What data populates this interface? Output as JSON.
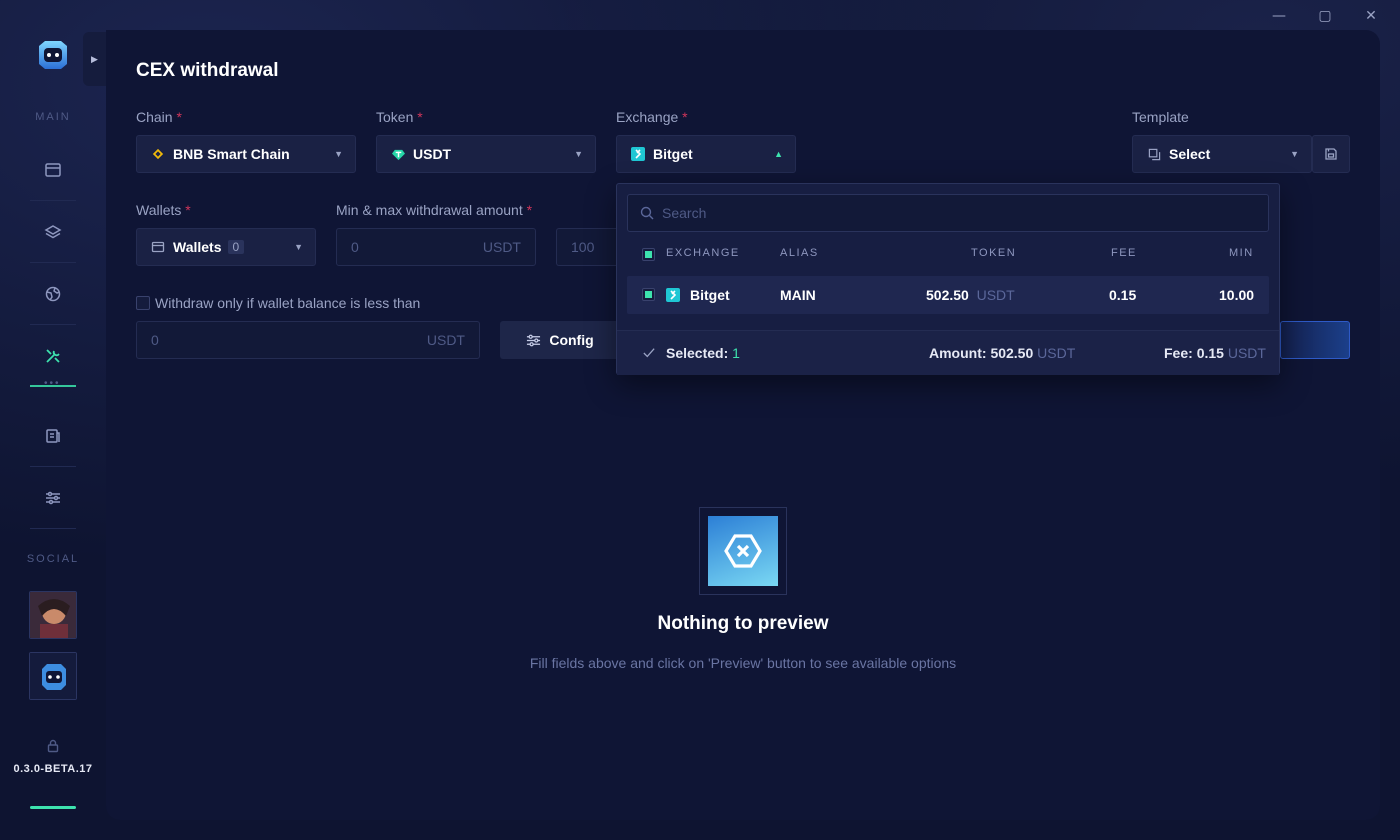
{
  "window": {
    "minimize": "—",
    "maximize": "▢",
    "close": "✕"
  },
  "sidebar": {
    "sections": {
      "main": "MAIN",
      "social": "SOCIAL"
    },
    "version": "0.3.0-BETA.17",
    "accent": "#3de3ae"
  },
  "page": {
    "title": "CEX withdrawal"
  },
  "form": {
    "chain": {
      "label": "Chain",
      "required": "*",
      "value": "BNB Smart Chain"
    },
    "token": {
      "label": "Token",
      "required": "*",
      "value": "USDT"
    },
    "exchange": {
      "label": "Exchange",
      "required": "*",
      "value": "Bitget"
    },
    "template": {
      "label": "Template",
      "value": "Select"
    },
    "wallets": {
      "label": "Wallets",
      "required": "*",
      "value": "Wallets",
      "count": "0"
    },
    "amount": {
      "label": "Min & max withdrawal amount",
      "required": "*",
      "min_placeholder": "0",
      "max_placeholder": "100",
      "unit": "USDT"
    },
    "balance_check": {
      "label": "Withdraw only if wallet balance is less than",
      "placeholder": "0",
      "unit": "USDT"
    },
    "config_button": "Config"
  },
  "exchange_dropdown": {
    "search_placeholder": "Search",
    "columns": {
      "exchange": "EXCHANGE",
      "alias": "ALIAS",
      "token": "TOKEN",
      "fee": "FEE",
      "min": "MIN"
    },
    "rows": [
      {
        "exchange": "Bitget",
        "alias": "MAIN",
        "token": "502.50",
        "token_unit": "USDT",
        "fee": "0.15",
        "min": "10.00"
      }
    ],
    "footer": {
      "selected_label": "Selected:",
      "selected_count": "1",
      "amount_label": "Amount:",
      "amount_value": "502.50",
      "amount_unit": "USDT",
      "fee_label": "Fee:",
      "fee_value": "0.15",
      "fee_unit": "USDT"
    }
  },
  "empty_state": {
    "title": "Nothing to preview",
    "subtitle": "Fill fields above and click on 'Preview' button to see available options"
  }
}
